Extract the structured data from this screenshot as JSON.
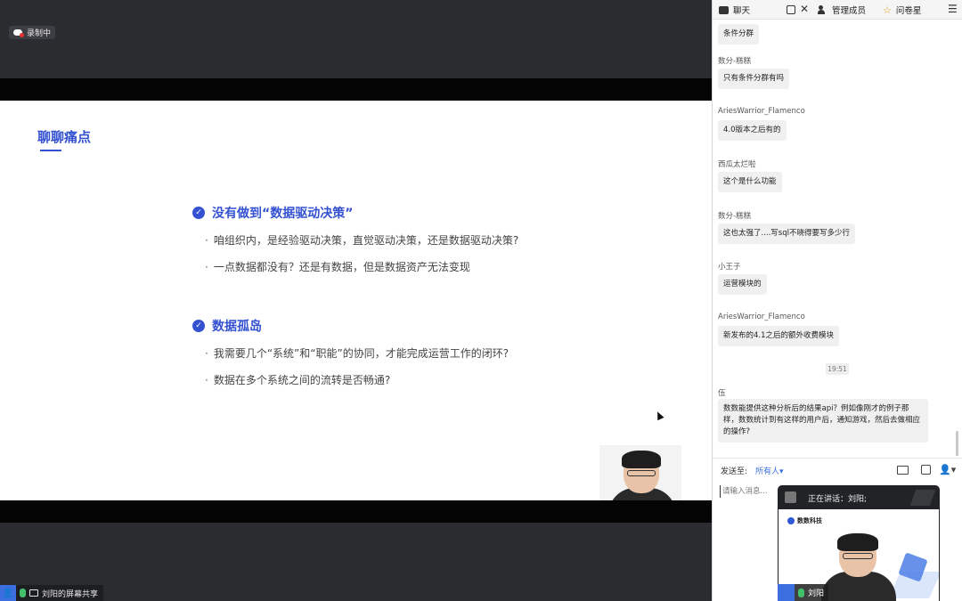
{
  "recording": {
    "label": "录制中"
  },
  "slide": {
    "title": "聊聊痛点",
    "sections": [
      {
        "title": "没有做到“数据驱动决策”",
        "bullets": [
          "咱组织内，是经验驱动决策，直觉驱动决策，还是数据驱动决策?",
          "一点数据都没有？还是有数据，但是数据资产无法变现"
        ]
      },
      {
        "title": "数据孤岛",
        "bullets": [
          "我需要几个“系统”和“职能”的协同，才能完成运营工作的闭环?",
          "数据在多个系统之间的流转是否畅通?"
        ]
      }
    ]
  },
  "share_label": "刘阳的屏幕共享",
  "chat": {
    "tabs": {
      "chat": "聊天",
      "members": "管理成员",
      "survey": "问卷星"
    },
    "messages": [
      {
        "sender": "",
        "text": "条件分群"
      },
      {
        "sender": "数分-糕糕",
        "text": "只有条件分群有吗"
      },
      {
        "sender": "AriesWarrior_Flamenco",
        "text": "4.0版本之后有的"
      },
      {
        "sender": "西瓜太烂啦",
        "text": "这个是什么功能"
      },
      {
        "sender": "数分-糕糕",
        "text": "这也太强了....写sql不晓得要写多少行"
      },
      {
        "sender": "小王子",
        "text": "运营模块的"
      },
      {
        "sender": "AriesWarrior_Flamenco",
        "text": "新发布的4.1之后的额外收费模块"
      },
      {
        "sender": "伍",
        "text": "数数能提供这种分析后的结果api？例如像刚才的例子那样，数数统计到有这样的用户后，通知游戏，然后去做相应的操作?"
      }
    ],
    "timestamp": "19:51",
    "send_to_label": "发送至:",
    "send_to_value": "所有人▾",
    "input_placeholder": "请输入消息..."
  },
  "speaker": {
    "status": "正在讲话：刘阳;",
    "brand": "数数科技",
    "name": "刘阳"
  },
  "colors": {
    "accent": "#3451d1",
    "link": "#3b6fe0",
    "mic": "#43c06a",
    "record": "#e5322d"
  }
}
